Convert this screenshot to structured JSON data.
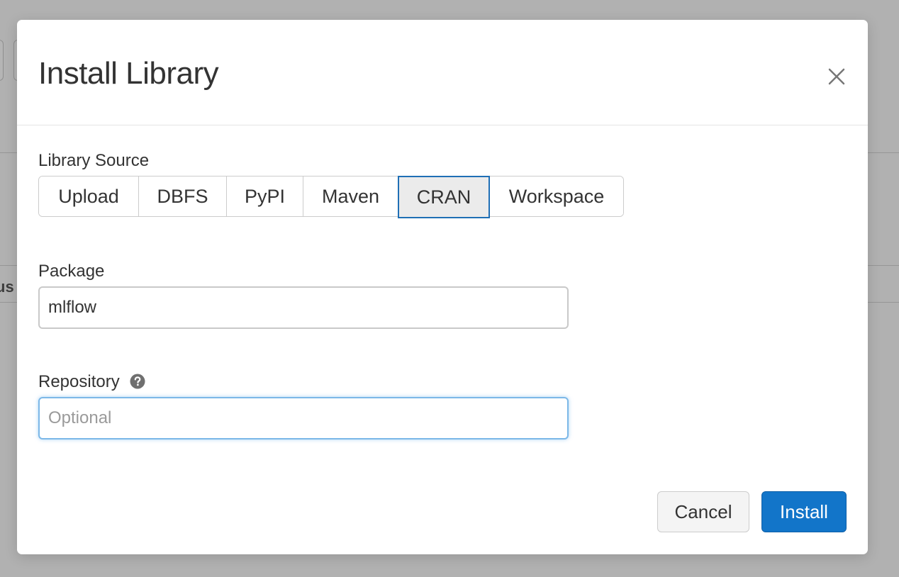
{
  "background": {
    "column_header_fragment": "us"
  },
  "modal": {
    "title": "Install Library",
    "close_icon": "close-icon"
  },
  "library_source": {
    "label": "Library Source",
    "options": [
      {
        "label": "Upload",
        "selected": false
      },
      {
        "label": "DBFS",
        "selected": false
      },
      {
        "label": "PyPI",
        "selected": false
      },
      {
        "label": "Maven",
        "selected": false
      },
      {
        "label": "CRAN",
        "selected": true
      },
      {
        "label": "Workspace",
        "selected": false
      }
    ]
  },
  "package": {
    "label": "Package",
    "value": "mlflow"
  },
  "repository": {
    "label": "Repository",
    "help_icon": "question-circle-icon",
    "value": "",
    "placeholder": "Optional"
  },
  "footer": {
    "cancel_label": "Cancel",
    "install_label": "Install"
  },
  "colors": {
    "primary": "#1275c9",
    "focus_border": "#7cb8e8",
    "backdrop": "#b1b1b1"
  }
}
